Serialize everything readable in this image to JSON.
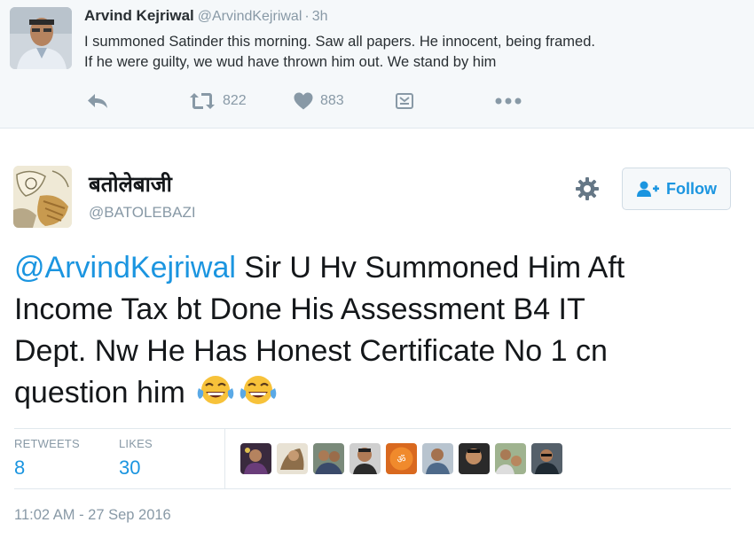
{
  "parent_tweet": {
    "name": "Arvind Kejriwal",
    "handle": "@ArvindKejriwal",
    "separator": "·",
    "time": "3h",
    "text_lines": [
      "I summoned Satinder this morning. Saw all papers. He innocent, being framed.",
      "If he were guilty, we wud have thrown him out. We stand by him"
    ],
    "retweet_count": "822",
    "like_count": "883"
  },
  "tweet": {
    "name": "बतोलेबाजी",
    "handle": "@BATOLEBAZI",
    "follow_label": "Follow",
    "mention": "@ArvindKejriwal",
    "text_lines": [
      " Sir U Hv Summoned Him Aft",
      "Income Tax bt Done His Assessment B4 IT",
      "Dept. Nw He Has Honest Certificate No 1 cn",
      "question him"
    ],
    "emojis": [
      "face-with-tears-of-joy",
      "face-with-tears-of-joy"
    ]
  },
  "stats": {
    "retweets_label": "RETWEETS",
    "retweets_value": "8",
    "likes_label": "LIKES",
    "likes_value": "30"
  },
  "timestamp": "11:02 AM - 27 Sep 2016",
  "icons": [
    "reply-icon",
    "retweet-icon",
    "heart-icon",
    "moments-icon",
    "more-icon",
    "gear-icon",
    "follow-person-icon"
  ],
  "colors": {
    "link_blue": "#1b95e0",
    "muted_gray": "#8899a6",
    "parent_bg": "#f5f8fa",
    "divider": "#e1e8ed"
  }
}
